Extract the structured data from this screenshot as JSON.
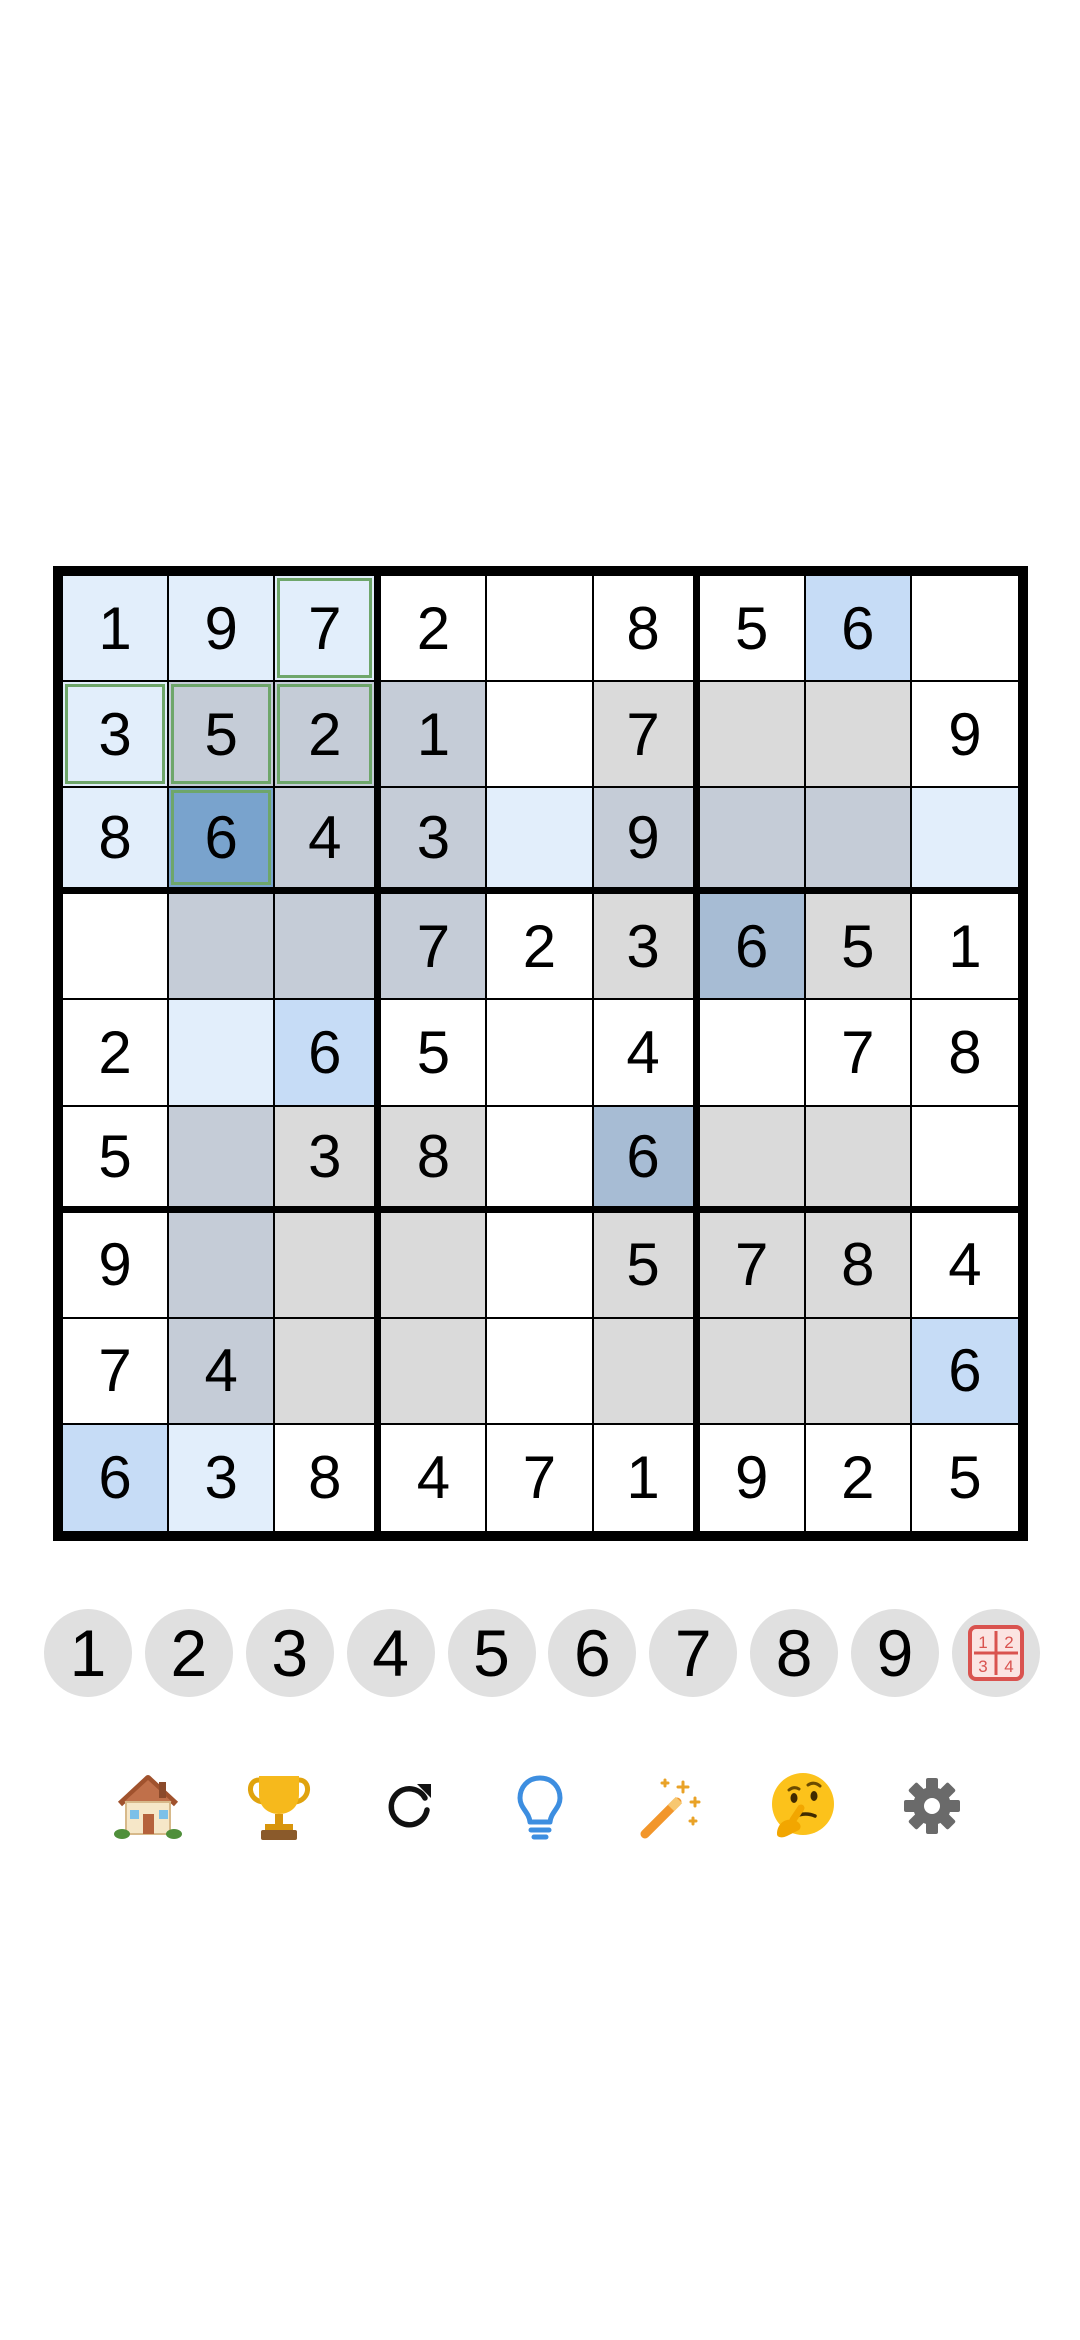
{
  "board": {
    "rows": [
      [
        "1",
        "9",
        "7",
        "2",
        "",
        "8",
        "5",
        "6",
        ""
      ],
      [
        "3",
        "5",
        "2",
        "1",
        "",
        "7",
        "",
        "",
        "9"
      ],
      [
        "8",
        "6",
        "4",
        "3",
        "",
        "9",
        "",
        "",
        ""
      ],
      [
        "",
        "",
        "",
        "7",
        "2",
        "3",
        "6",
        "5",
        "1"
      ],
      [
        "2",
        "",
        "6",
        "5",
        "",
        "4",
        "",
        "7",
        "8"
      ],
      [
        "5",
        "",
        "3",
        "8",
        "",
        "6",
        "",
        "",
        ""
      ],
      [
        "9",
        "",
        "",
        "",
        "",
        "5",
        "7",
        "8",
        "4"
      ],
      [
        "7",
        "4",
        "",
        "",
        "",
        "",
        "",
        "",
        "6"
      ],
      [
        "6",
        "3",
        "8",
        "4",
        "7",
        "1",
        "9",
        "2",
        "5"
      ]
    ],
    "shading": [
      [
        "lightblue",
        "lightblue",
        "lightblue",
        "white",
        "white",
        "white",
        "white",
        "blue",
        "white"
      ],
      [
        "lightblue",
        "bluegray",
        "bluegray",
        "bluegray",
        "white",
        "gray",
        "gray",
        "gray",
        "white"
      ],
      [
        "lightblue",
        "sel",
        "bluegray",
        "bluegray",
        "lightblue",
        "bluegray",
        "bluegray",
        "bluegray",
        "lightblue"
      ],
      [
        "white",
        "bluegray",
        "bluegray",
        "bluegray",
        "white",
        "gray",
        "mid",
        "gray",
        "white"
      ],
      [
        "white",
        "lightblue",
        "blue",
        "white",
        "white",
        "white",
        "white",
        "white",
        "white"
      ],
      [
        "white",
        "bluegray",
        "gray",
        "gray",
        "white",
        "mid",
        "gray",
        "gray",
        "white"
      ],
      [
        "white",
        "bluegray",
        "gray",
        "gray",
        "white",
        "gray",
        "gray",
        "gray",
        "white"
      ],
      [
        "white",
        "bluegray",
        "gray",
        "gray",
        "white",
        "gray",
        "gray",
        "gray",
        "blue"
      ],
      [
        "blue",
        "lightblue",
        "white",
        "white",
        "white",
        "white",
        "white",
        "white",
        "white"
      ]
    ],
    "cage_cells": [
      [
        0,
        2
      ],
      [
        1,
        0
      ],
      [
        1,
        1
      ],
      [
        1,
        2
      ],
      [
        2,
        1
      ]
    ],
    "colors": {
      "lightblue": "#e2eefb",
      "blue": "#c6dcf6",
      "gray": "#dadada",
      "bluegray": "#c5ccd7",
      "mid": "#a7bcd4",
      "selected": "#79a3cd",
      "cage_outline": "#6ea66a"
    }
  },
  "numpad": {
    "digits": [
      "1",
      "2",
      "3",
      "4",
      "5",
      "6",
      "7",
      "8",
      "9"
    ],
    "notes_icon": "notes-grid-icon",
    "notes_digits": [
      "1",
      "2",
      "3",
      "4"
    ]
  },
  "toolbar": {
    "items": [
      {
        "name": "home",
        "icon": "house-icon"
      },
      {
        "name": "trophy",
        "icon": "trophy-icon"
      },
      {
        "name": "restart",
        "icon": "refresh-icon"
      },
      {
        "name": "hint",
        "icon": "lightbulb-icon"
      },
      {
        "name": "magic",
        "icon": "magic-wand-icon"
      },
      {
        "name": "thinking",
        "icon": "thinking-face-icon"
      },
      {
        "name": "settings",
        "icon": "gear-icon"
      }
    ]
  }
}
